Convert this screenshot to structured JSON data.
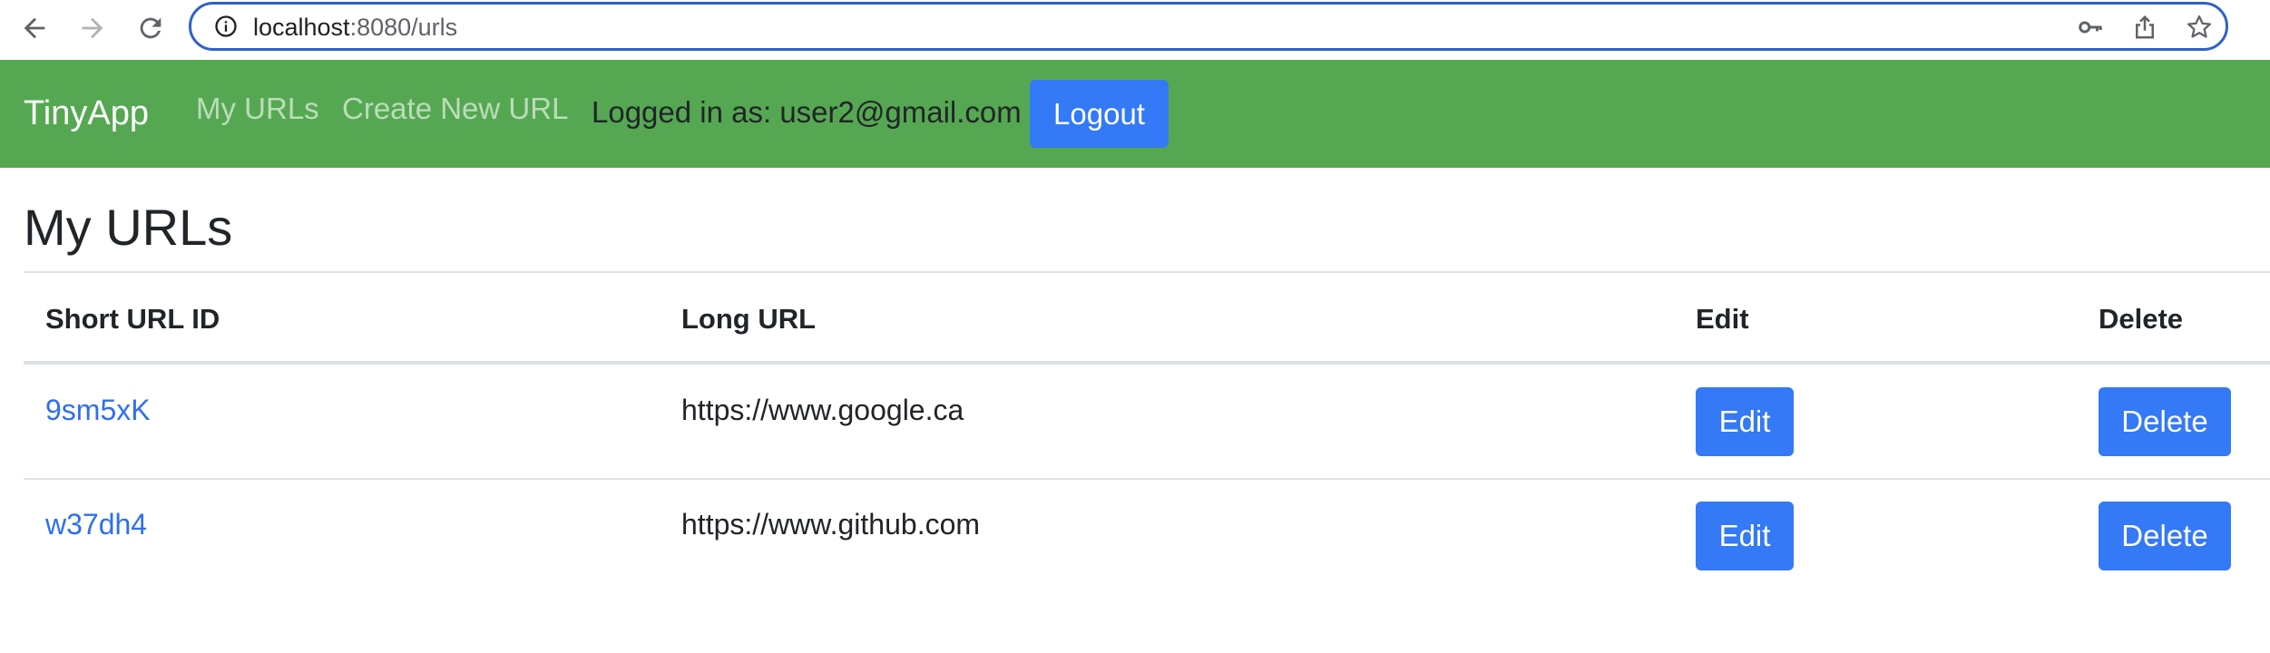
{
  "browser": {
    "url_host": "localhost",
    "url_rest": ":8080/urls"
  },
  "navbar": {
    "brand": "TinyApp",
    "links": [
      {
        "label": "My URLs"
      },
      {
        "label": "Create New URL"
      }
    ],
    "logged_in_text": "Logged in as: user2@gmail.com",
    "logout_label": "Logout",
    "bg_color": "#55a851",
    "accent_color": "#3479f5"
  },
  "main": {
    "title": "My URLs",
    "table": {
      "headers": [
        "Short URL ID",
        "Long URL",
        "Edit",
        "Delete"
      ],
      "rows": [
        {
          "short_id": "9sm5xK",
          "long_url": "https://www.google.ca",
          "edit_label": "Edit",
          "delete_label": "Delete"
        },
        {
          "short_id": "w37dh4",
          "long_url": "https://www.github.com",
          "edit_label": "Edit",
          "delete_label": "Delete"
        }
      ]
    }
  }
}
